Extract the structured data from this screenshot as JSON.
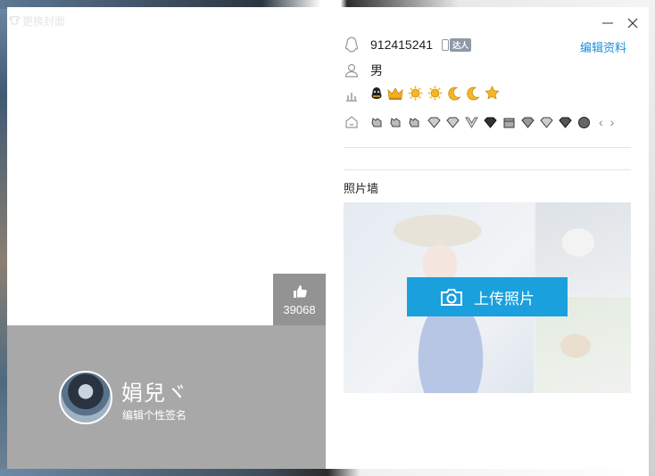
{
  "window": {
    "bg_hint": "更换封面"
  },
  "profile": {
    "nickname": "娟兒ヾ",
    "signature": "编辑个性签名",
    "likes": "39068"
  },
  "info": {
    "qq_number": "912415241",
    "vip_badge": "达人",
    "gender": "男",
    "edit_label": "编辑资料",
    "level_icons": [
      "penguin-level-icon",
      "crown-icon",
      "sun-icon",
      "sun-icon",
      "moon-icon",
      "moon-icon",
      "star-icon"
    ],
    "service_icon_count": 13
  },
  "photos": {
    "title": "照片墙",
    "upload_label": "上传照片"
  },
  "colors": {
    "accent": "#1aa0dc",
    "cover_bottom": "#a8a8a8",
    "like_box": "#939393",
    "edit_link": "#1a8fd6"
  }
}
